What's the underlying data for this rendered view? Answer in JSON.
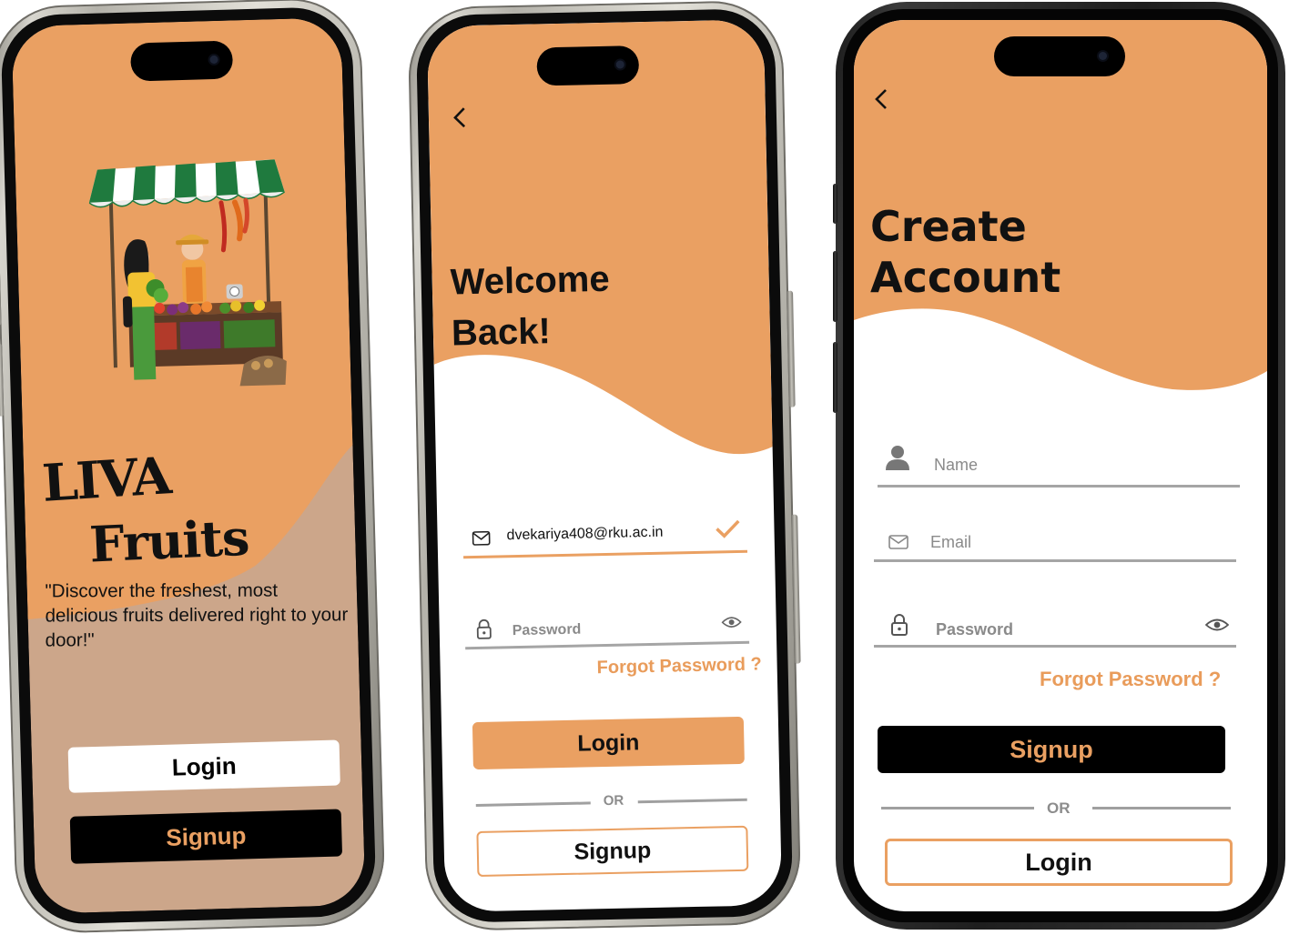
{
  "colors": {
    "accent": "#eaa062",
    "taupe": "#cca68a",
    "black": "#000000",
    "white": "#ffffff",
    "muted": "#8a8a8a"
  },
  "splash": {
    "brand_line1": "LIVA",
    "brand_line2": "Fruits",
    "tagline": "\"Discover the freshest, most delicious fruits delivered right to your door!\"",
    "login_label": "Login",
    "signup_label": "Signup"
  },
  "login": {
    "back_icon": "chevron-left-icon",
    "heading_line1": "Welcome",
    "heading_line2": "Back!",
    "email_value": "dvekariya408@rku.ac.in",
    "password_placeholder": "Password",
    "forgot_label": "Forgot Password ?",
    "login_label": "Login",
    "or_label": "OR",
    "signup_label": "Signup"
  },
  "signup": {
    "back_icon": "chevron-left-icon",
    "heading_line1": "Create",
    "heading_line2": "Account",
    "name_placeholder": "Name",
    "email_placeholder": "Email",
    "password_placeholder": "Password",
    "forgot_label": "Forgot Password ?",
    "signup_label": "Signup",
    "or_label": "OR",
    "login_label": "Login"
  }
}
